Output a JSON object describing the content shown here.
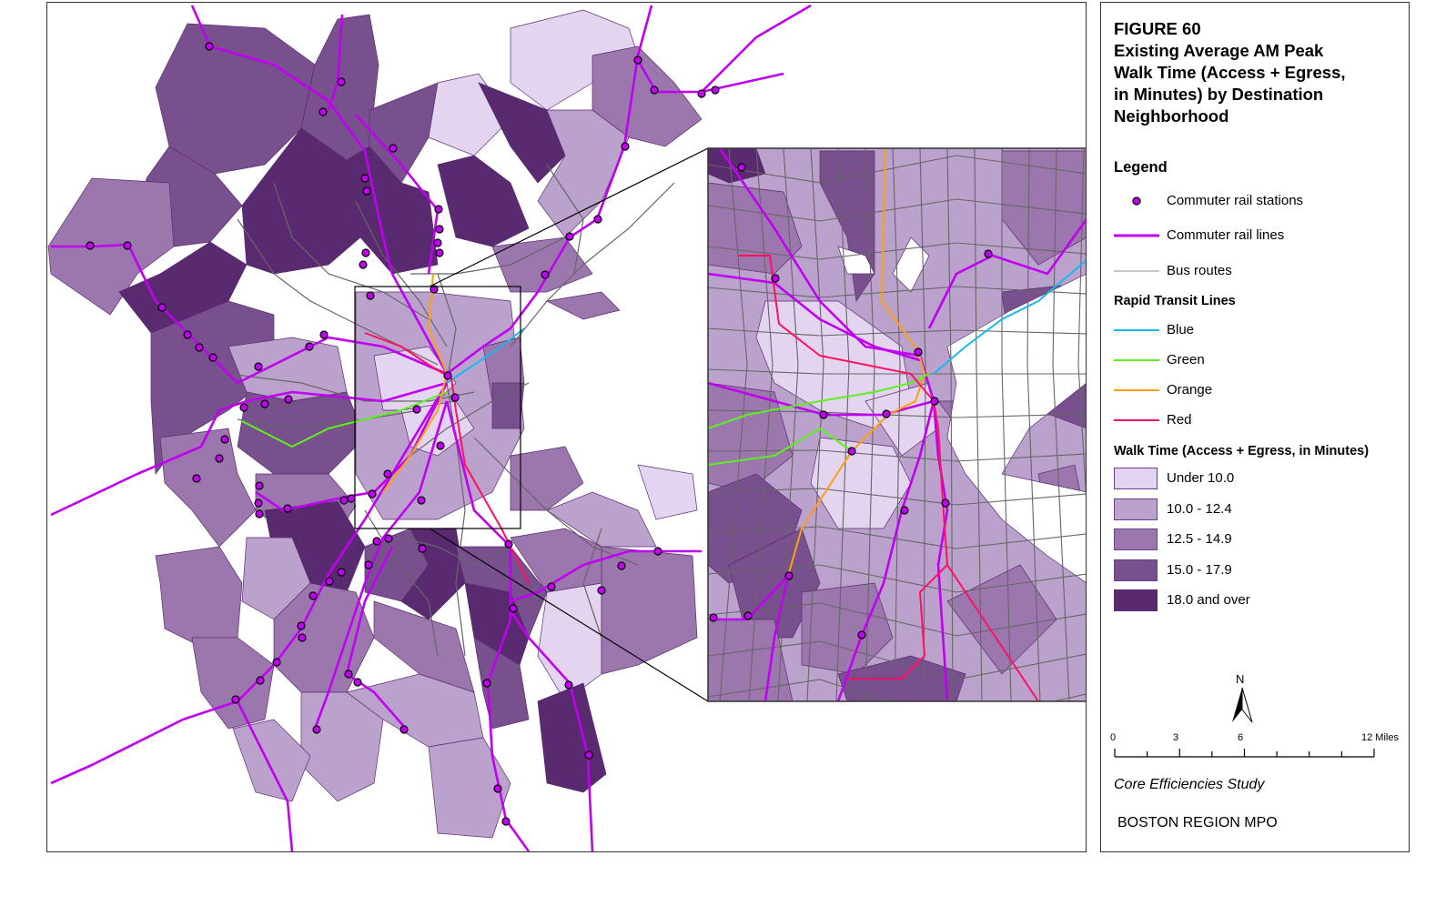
{
  "figure": {
    "number": "FIGURE 60",
    "title_lines": [
      "Existing Average AM Peak",
      "Walk Time (Access + Egress,",
      "in Minutes) by Destination",
      "Neighborhood"
    ]
  },
  "legend": {
    "heading": "Legend",
    "items": [
      {
        "label": "Commuter rail stations",
        "icon": "station-dot-icon",
        "color": "#c000f0"
      },
      {
        "label": "Commuter rail lines",
        "icon": "line-icon",
        "color": "#c000f0"
      },
      {
        "label": "Bus routes",
        "icon": "line-icon",
        "color": "#a8a8a8"
      }
    ],
    "rapid_transit_heading": "Rapid Transit Lines",
    "rapid_transit": [
      {
        "label": "Blue",
        "color": "#1ab8f0"
      },
      {
        "label": "Green",
        "color": "#5ef020"
      },
      {
        "label": "Orange",
        "color": "#ffa010"
      },
      {
        "label": "Red",
        "color": "#ff1060"
      }
    ],
    "walk_time_heading": "Walk Time (Access + Egress, in Minutes)",
    "walk_time_classes": [
      {
        "label": "Under 10.0",
        "color": "#e3d4f0"
      },
      {
        "label": "10.0 - 12.4",
        "color": "#bba2cd"
      },
      {
        "label": "12.5 - 14.9",
        "color": "#9b77ad"
      },
      {
        "label": "15.0 - 17.9",
        "color": "#79508e"
      },
      {
        "label": "18.0 and over",
        "color": "#5a2a70"
      }
    ]
  },
  "north_arrow": {
    "label": "N"
  },
  "scale_bar": {
    "ticks": [
      "0",
      "3",
      "6",
      "12 Miles"
    ]
  },
  "credits": {
    "study": "Core Efficiencies Study",
    "agency": "BOSTON REGION MPO"
  },
  "map": {
    "bus_route_color": "#666666",
    "boundary_color": "#5a2a70",
    "inset_frame_color": "#000000"
  }
}
